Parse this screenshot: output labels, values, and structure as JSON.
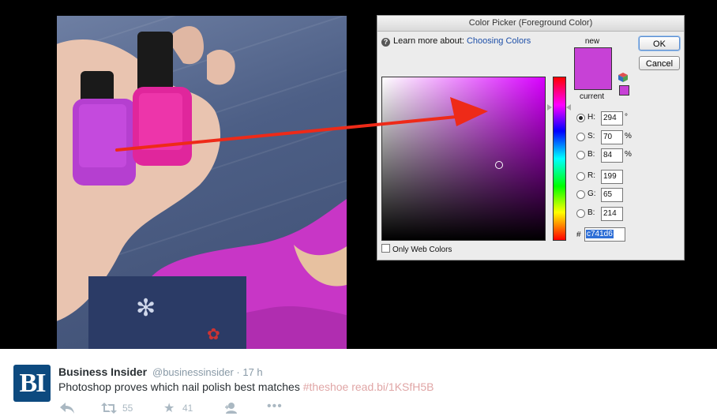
{
  "color_picker": {
    "title": "Color Picker (Foreground Color)",
    "learn_text": "Learn more about:",
    "learn_link": "Choosing Colors",
    "new_label": "new",
    "current_label": "current",
    "ok_label": "OK",
    "cancel_label": "Cancel",
    "new_color": "#c741d6",
    "current_color": "#c741d6",
    "fields": [
      {
        "label": "H:",
        "value": "294",
        "unit": "°",
        "selected": true
      },
      {
        "label": "S:",
        "value": "70",
        "unit": "%",
        "selected": false
      },
      {
        "label": "B:",
        "value": "84",
        "unit": "%",
        "selected": false
      },
      {
        "label": "R:",
        "value": "199",
        "unit": "",
        "selected": false
      },
      {
        "label": "G:",
        "value": "65",
        "unit": "",
        "selected": false
      },
      {
        "label": "B:",
        "value": "214",
        "unit": "",
        "selected": false
      }
    ],
    "hex_label": "#",
    "hex_value": "c741d6",
    "web_colors_label": "Only Web Colors"
  },
  "tweet": {
    "avatar_text": "BI",
    "name": "Business Insider",
    "handle_time": "@businessinsider · 17 h",
    "text": "Photoshop proves which nail polish best matches ",
    "hashtag": "#theshoe",
    "link": " read.bi/1KSfH5B",
    "retweets": "55",
    "favorites": "41"
  },
  "colors": {
    "accent_link": "#1d4fa8",
    "bi_blue": "#0d4a7f",
    "polish_pink": "#c741d6"
  }
}
